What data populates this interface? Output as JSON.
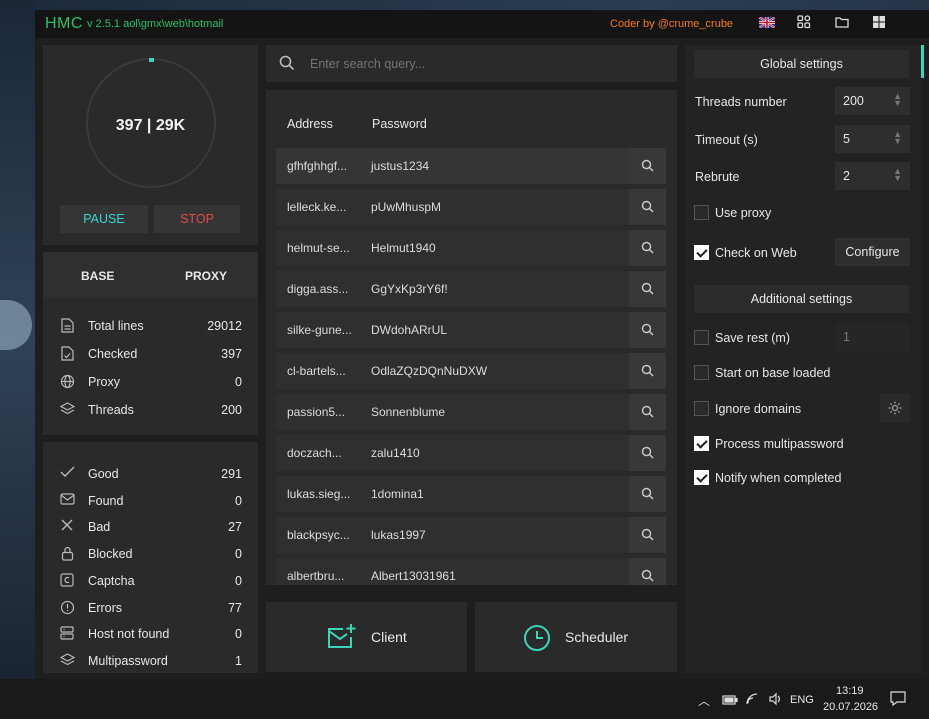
{
  "titlebar": {
    "logo": "HMC",
    "version": "v 2.5.1 aol\\gmx\\web\\hotmail",
    "coder": "Coder by @crume_crube",
    "icons": [
      "flag-uk-icon",
      "apps-icon",
      "folder-icon",
      "windows-icon"
    ]
  },
  "progress": {
    "count": "397 | 29K",
    "pause_label": "PAUSE",
    "stop_label": "STOP",
    "pause_color": "#3ad6d6",
    "stop_color": "#e04b4b"
  },
  "tabs": {
    "base": "BASE",
    "proxy": "PROXY"
  },
  "base_stats": [
    {
      "label": "Total lines",
      "value": "29012",
      "icon": "file-icon"
    },
    {
      "label": "Checked",
      "value": "397",
      "icon": "file-check-icon"
    },
    {
      "label": "Proxy",
      "value": "0",
      "icon": "globe-icon"
    },
    {
      "label": "Threads",
      "value": "200",
      "icon": "layers-icon"
    }
  ],
  "result_stats": [
    {
      "label": "Good",
      "value": "291",
      "icon": "check-icon"
    },
    {
      "label": "Found",
      "value": "0",
      "icon": "mail-icon"
    },
    {
      "label": "Bad",
      "value": "27",
      "icon": "x-icon"
    },
    {
      "label": "Blocked",
      "value": "0",
      "icon": "lock-icon"
    },
    {
      "label": "Captcha",
      "value": "0",
      "icon": "captcha-icon"
    },
    {
      "label": "Errors",
      "value": "77",
      "icon": "alert-icon"
    },
    {
      "label": "Host not found",
      "value": "0",
      "icon": "server-icon"
    },
    {
      "label": "Multipassword",
      "value": "1",
      "icon": "layers-icon"
    }
  ],
  "search": {
    "placeholder": "Enter search query..."
  },
  "table": {
    "headers": [
      "Address",
      "Password"
    ],
    "rows": [
      {
        "address": "gfhfghhgf...",
        "password": "justus1234"
      },
      {
        "address": "lelleck.ke...",
        "password": "pUwMhuspM"
      },
      {
        "address": "helmut-se...",
        "password": "Helmut1940"
      },
      {
        "address": "digga.ass...",
        "password": "GgYxKp3rY6f!"
      },
      {
        "address": "silke-gune...",
        "password": "DWdohARrUL"
      },
      {
        "address": "cl-bartels...",
        "password": "OdlaZQzDQnNuDXW"
      },
      {
        "address": "passion5...",
        "password": "Sonnenblume"
      },
      {
        "address": "doczach...",
        "password": "zalu1410"
      },
      {
        "address": "lukas.sieg...",
        "password": "1domina1"
      },
      {
        "address": "blackpsyc...",
        "password": "lukas1997"
      },
      {
        "address": "albertbru...",
        "password": "Albert13031961"
      }
    ]
  },
  "bottom_buttons": {
    "client": "Client",
    "scheduler": "Scheduler"
  },
  "global_settings": {
    "title": "Global settings",
    "threads_label": "Threads number",
    "threads_value": "200",
    "timeout_label": "Timeout (s)",
    "timeout_value": "5",
    "rebrute_label": "Rebrute",
    "rebrute_value": "2",
    "use_proxy": "Use proxy",
    "check_on_web": "Check on Web",
    "configure": "Configure"
  },
  "additional_settings": {
    "title": "Additional settings",
    "save_rest": "Save rest (m)",
    "save_rest_value": "1",
    "start_on_base": "Start on base loaded",
    "ignore_domains": "Ignore domains",
    "process_multi": "Process multipassword",
    "notify": "Notify when completed"
  },
  "taskbar": {
    "lang": "ENG",
    "time": "13:19",
    "date": "20.07.2026"
  }
}
